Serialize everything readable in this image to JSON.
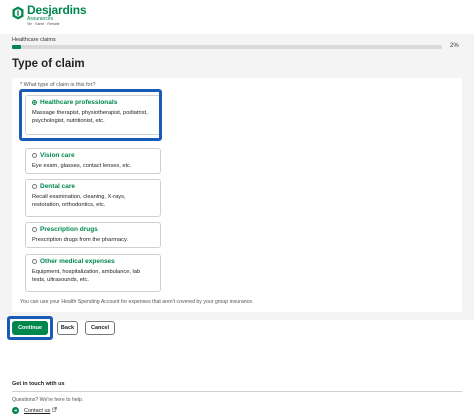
{
  "header": {
    "brand": "Desjardins",
    "sub": "Assurances",
    "tagline": "Vie · Santé · Retraite"
  },
  "breadcrumb": "Healthcare claims",
  "progress": {
    "percent": 2,
    "label": "2%"
  },
  "page_title": "Type of claim",
  "question": "* What type of claim is this for?",
  "options": [
    {
      "title": "Healthcare professionals",
      "desc": "Massage therapist, physiotherapist, podiatrist, psychologist, nutritionist, etc.",
      "selected": true
    },
    {
      "title": "Vision care",
      "desc": "Eye exam, glasses, contact lenses, etc.",
      "selected": false
    },
    {
      "title": "Dental care",
      "desc": "Recall examination, cleaning, X-rays, restoration, orthodontics, etc.",
      "selected": false
    },
    {
      "title": "Prescription drugs",
      "desc": "Prescription drugs from the pharmacy.",
      "selected": false
    },
    {
      "title": "Other medical expenses",
      "desc": "Equipment, hospitalization, ambulance, lab tests, ultrasounds, etc.",
      "selected": false
    }
  ],
  "hsa_note": "You can use your Health Spending Account for expenses that aren't covered by your group insurance.",
  "buttons": {
    "continue": "Continue",
    "back": "Back",
    "cancel": "Cancel"
  },
  "footer": {
    "title": "Get in touch with us",
    "question": "Questions? We're here to help.",
    "contact": "Contact us"
  },
  "colors": {
    "brand_green": "#00874e",
    "highlight_blue": "#1a5bb8",
    "background_gray": "#f4f4f4"
  },
  "icons": {
    "logo": "desjardins-hexagon-logo",
    "contact": "chat-arrow-icon",
    "external": "external-link-icon"
  }
}
